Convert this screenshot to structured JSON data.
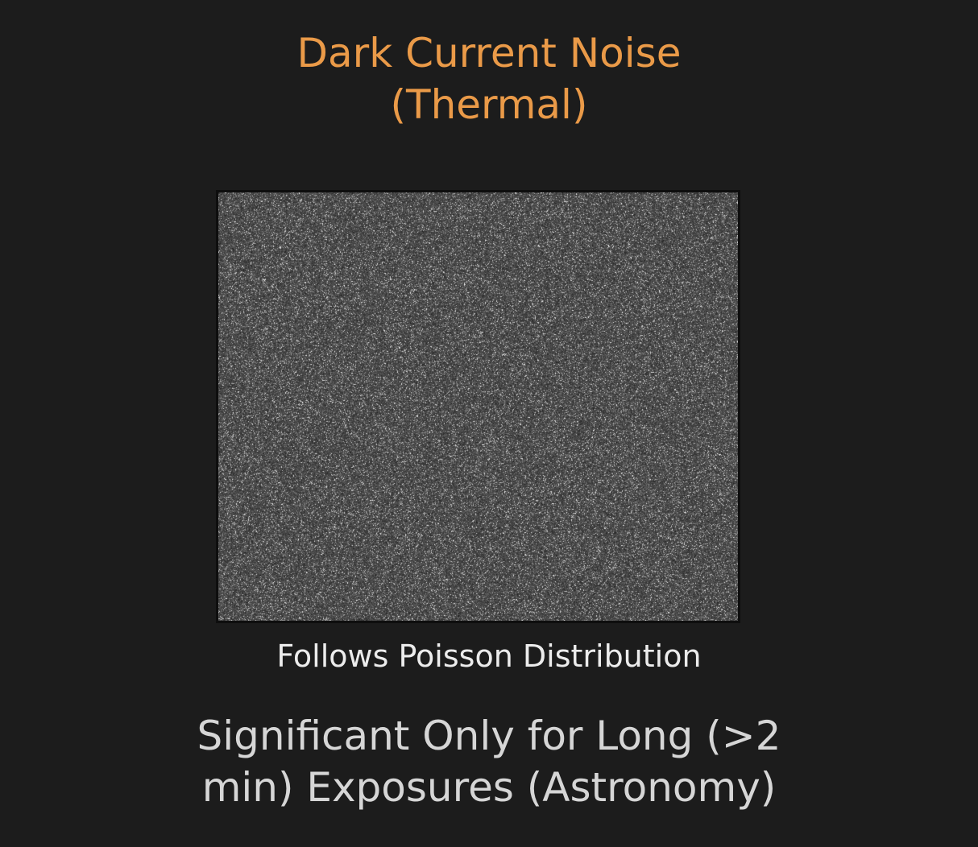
{
  "slide": {
    "title_line1": "Dark Current Noise",
    "title_line2": "(Thermal)",
    "caption": "Follows Poisson Distribution",
    "note_line1": "Significant Only for Long (>2",
    "note_line2": "min) Exposures (Astronomy)"
  },
  "colors": {
    "background": "#1c1c1c",
    "title": "#ea9a48",
    "caption": "#ececec",
    "note": "#d6d6d6"
  }
}
